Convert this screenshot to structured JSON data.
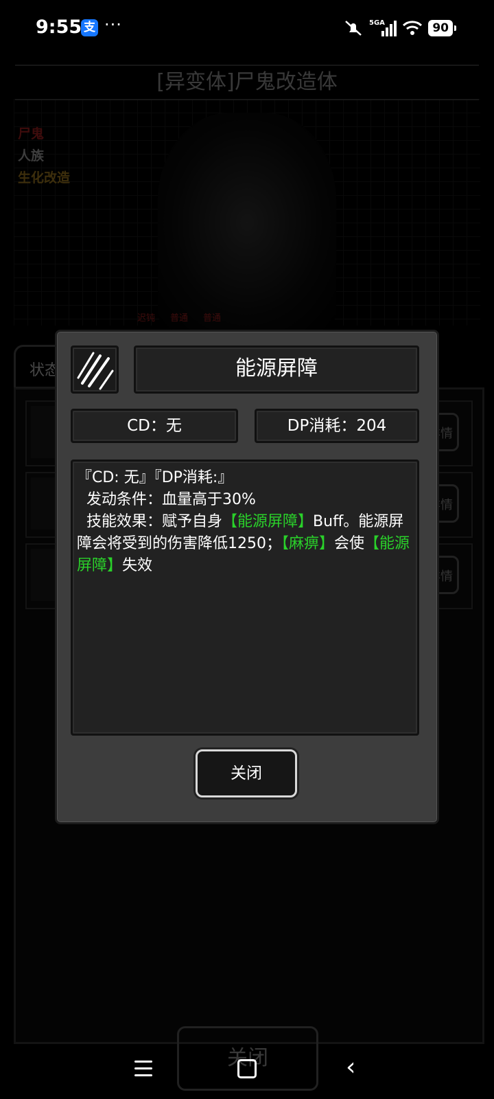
{
  "status_bar": {
    "time": "9:55",
    "app_badge": "支",
    "more": "···",
    "network": "5GA",
    "battery": "90"
  },
  "background": {
    "title": "[异变体]尸鬼改造体",
    "tags": [
      {
        "label": "尸鬼",
        "color": "#d92b2b"
      },
      {
        "label": "人族",
        "color": "#dddddd"
      },
      {
        "label": "生化改造",
        "color": "#d9a62b"
      }
    ],
    "stats": [
      "迟钝",
      "普通",
      "普通"
    ],
    "tab": "状态",
    "detail_label": "详情",
    "close": "关闭"
  },
  "modal": {
    "skill_name": "能源屏障",
    "cd": "CD：无",
    "dp_cost": "DP消耗：204",
    "desc": {
      "line1": "『CD: 无』『DP消耗:』",
      "line2": "  发动条件：血量高于30%",
      "line3_a": "  技能效果：赋予自身",
      "line3_b": "【能源屏障】",
      "line3_c": "Buff。能源屏障会将受到的伤害降低1250；",
      "line3_d": "【麻痹】",
      "line3_e": "会使",
      "line3_f": "【能源屏障】",
      "line3_g": "失效"
    },
    "close_label": "关闭"
  }
}
